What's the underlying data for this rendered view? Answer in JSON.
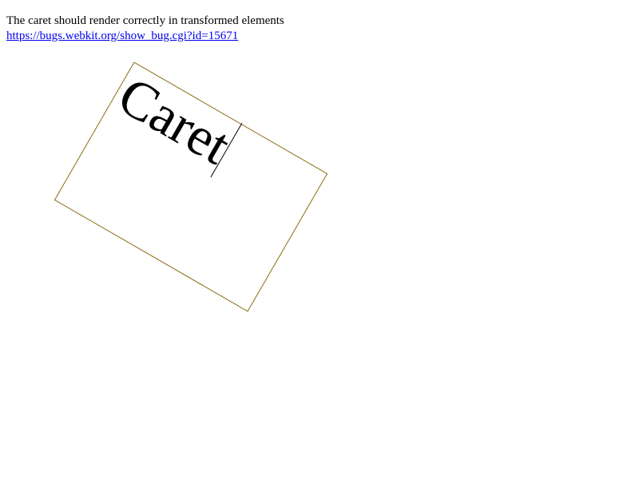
{
  "header": {
    "description": "The caret should render correctly in transformed elements",
    "link_text": "https://bugs.webkit.org/show_bug.cgi?id=15671"
  },
  "editor": {
    "content": "Caret"
  },
  "colors": {
    "box_border": "#8a6d12",
    "link": "#0000ee"
  }
}
